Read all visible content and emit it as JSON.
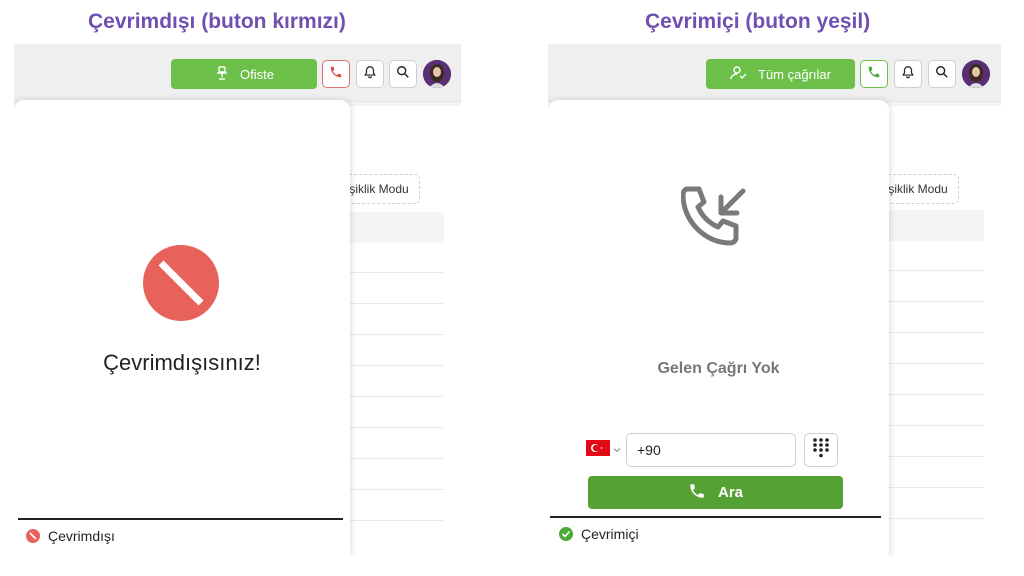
{
  "captions": {
    "left": "Çevrimdışı (buton kırmızı)",
    "right": "Çevrimiçi (buton yeşil)"
  },
  "offline_panel": {
    "status_button_label": "Ofiste",
    "status_icon": "desk-chair-icon",
    "call_icon_color": "#d9534f",
    "mode_button_label": "ğişiklik Modu",
    "message": "Çevrimdışısınız!",
    "footer_status": "Çevrimdışı",
    "status_color": "#e8625c"
  },
  "online_panel": {
    "status_button_label": "Tüm çağrılar",
    "status_icon": "person-check-icon",
    "call_icon_color": "#4caa3a",
    "mode_button_label": "ğişiklik Modu",
    "empty_state": "Gelen Çağrı Yok",
    "phone_prefix": "+90",
    "call_button_label": "Ara",
    "footer_status": "Çevrimiçi",
    "status_color": "#4caa3a"
  },
  "colors": {
    "caption": "#7050b0",
    "status_button": "#6cc04a",
    "call_button": "#56a133"
  }
}
